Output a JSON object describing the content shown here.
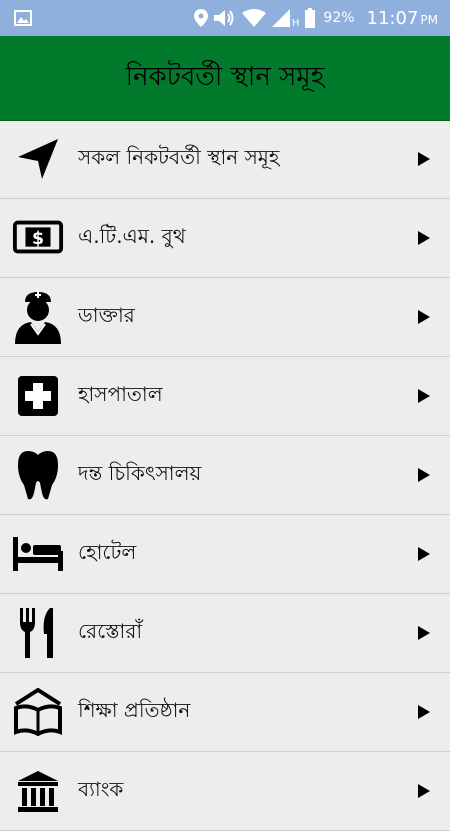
{
  "status_bar": {
    "network_label": "H",
    "battery": "92%",
    "time": "11:07",
    "ampm": "PM"
  },
  "app_bar": {
    "title": "নিকটবর্তী স্থান সমূহ"
  },
  "list": {
    "items": [
      {
        "label": "সকল নিকটবর্তী স্থান সমূহ",
        "icon": "navigation-arrow-icon"
      },
      {
        "label": "এ.টি.এম. বুথ",
        "icon": "cash-icon"
      },
      {
        "label": "ডাক্তার",
        "icon": "doctor-icon"
      },
      {
        "label": "হাসপাতাল",
        "icon": "hospital-cross-icon"
      },
      {
        "label": "দন্ত চিকিৎসালয়",
        "icon": "tooth-icon"
      },
      {
        "label": "হোটেল",
        "icon": "bed-icon"
      },
      {
        "label": "রেস্তোরাঁ",
        "icon": "fork-knife-icon"
      },
      {
        "label": "শিক্ষা প্রতিষ্ঠান",
        "icon": "book-icon"
      },
      {
        "label": "ব্যাংক",
        "icon": "bank-icon"
      }
    ]
  },
  "colors": {
    "status_bar": "#8fb0dc",
    "app_bar": "#027a2b",
    "background": "#ededed"
  }
}
